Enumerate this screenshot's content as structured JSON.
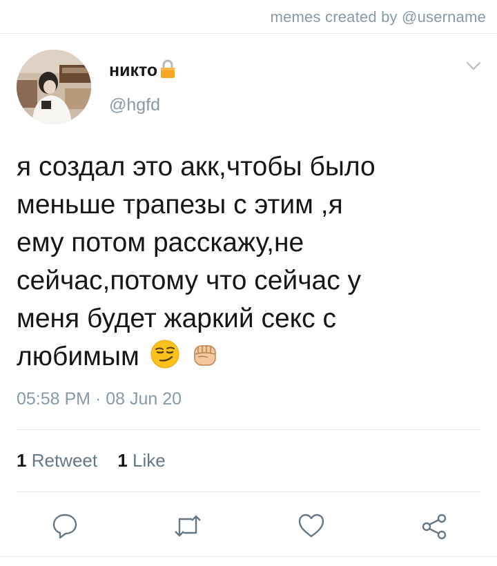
{
  "header": {
    "credit": "memes created by @username"
  },
  "tweet": {
    "name": "никто",
    "handle": "@hgfd",
    "text_lines": [
      "я создал это акк,чтобы было",
      "меньше трапезы с этим ,я",
      "ему потом расскажу,не",
      "сейчас,потому что сейчас у",
      "меня будет жаркий секс с",
      "любимым"
    ],
    "emojis": [
      "smirking-face",
      "raised-fist"
    ],
    "timestamp": "05:58 PM · 08 Jun 20",
    "retweet_count": "1",
    "retweet_label": "Retweet",
    "like_count": "1",
    "like_label": "Like"
  },
  "colors": {
    "text": "#14171a",
    "muted": "#8899a6",
    "divider": "#e1e8ed",
    "lock": "#f5a623"
  },
  "actions": [
    "reply-icon",
    "retweet-icon",
    "like-icon",
    "share-icon"
  ]
}
